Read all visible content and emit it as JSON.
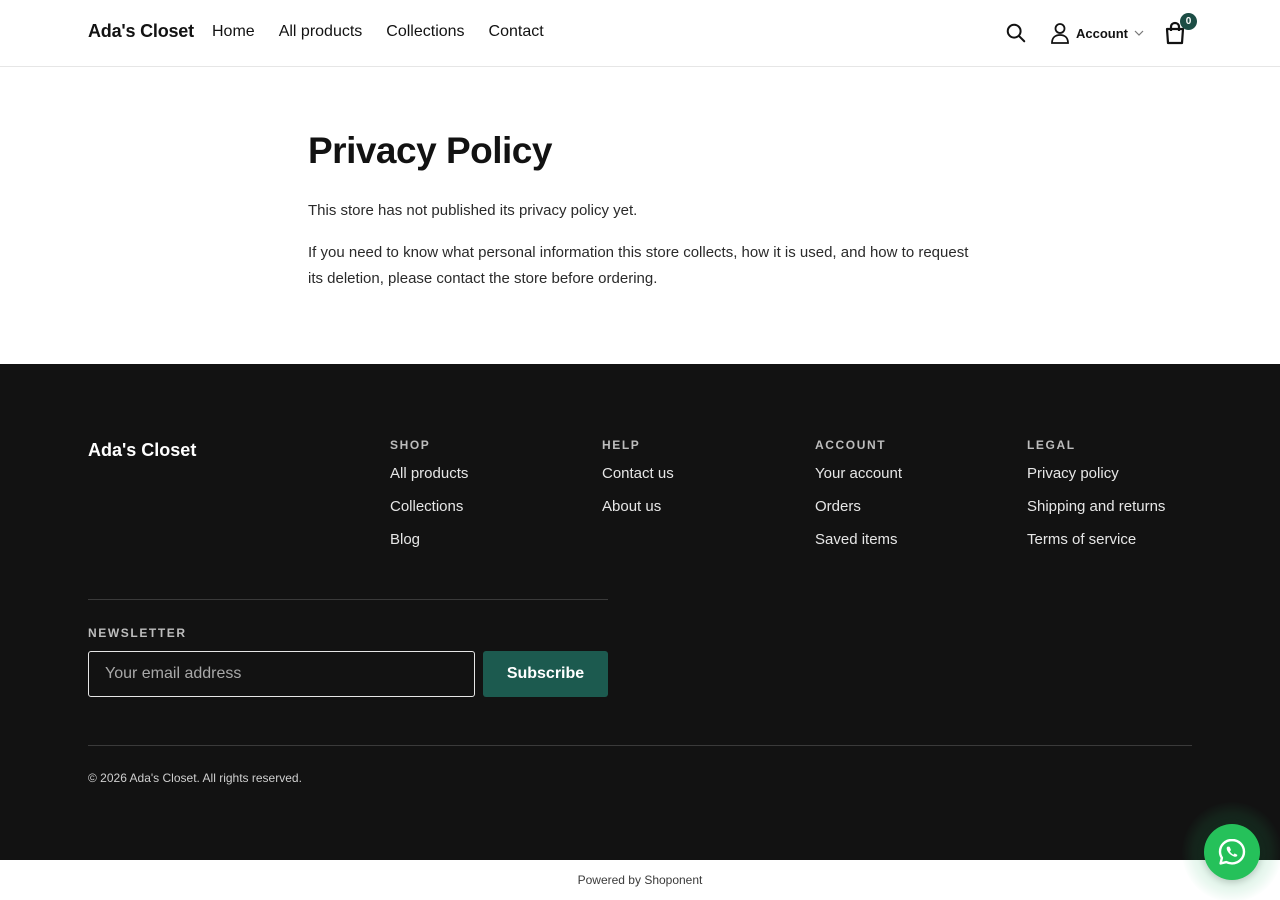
{
  "header": {
    "brand": "Ada's Closet",
    "nav": [
      {
        "label": "Home"
      },
      {
        "label": "All products"
      },
      {
        "label": "Collections"
      },
      {
        "label": "Contact"
      }
    ],
    "account_label": "Account",
    "cart_count": "0"
  },
  "main": {
    "title": "Privacy Policy",
    "paragraphs": [
      "This store has not published its privacy policy yet.",
      "If you need to know what personal information this store collects, how it is used, and how to request its deletion, please contact the store before ordering."
    ]
  },
  "footer": {
    "brand": "Ada's Closet",
    "columns": [
      {
        "title": "SHOP",
        "links": [
          "All products",
          "Collections",
          "Blog"
        ]
      },
      {
        "title": "HELP",
        "links": [
          "Contact us",
          "About us"
        ]
      },
      {
        "title": "ACCOUNT",
        "links": [
          "Your account",
          "Orders",
          "Saved items"
        ]
      },
      {
        "title": "LEGAL",
        "links": [
          "Privacy policy",
          "Shipping and returns",
          "Terms of service"
        ]
      }
    ],
    "newsletter": {
      "title": "NEWSLETTER",
      "placeholder": "Your email address",
      "button": "Subscribe"
    },
    "copyright": "© 2026 Ada's Closet. All rights reserved."
  },
  "powered_by": "Powered by Shoponent",
  "colors": {
    "accent": "#1c5a4f",
    "footer_bg": "#121212",
    "chat": "#25c15a"
  },
  "icons": {
    "search": "search-icon",
    "account": "user-icon",
    "cart": "shopping-bag-icon",
    "chat": "whatsapp-icon"
  }
}
